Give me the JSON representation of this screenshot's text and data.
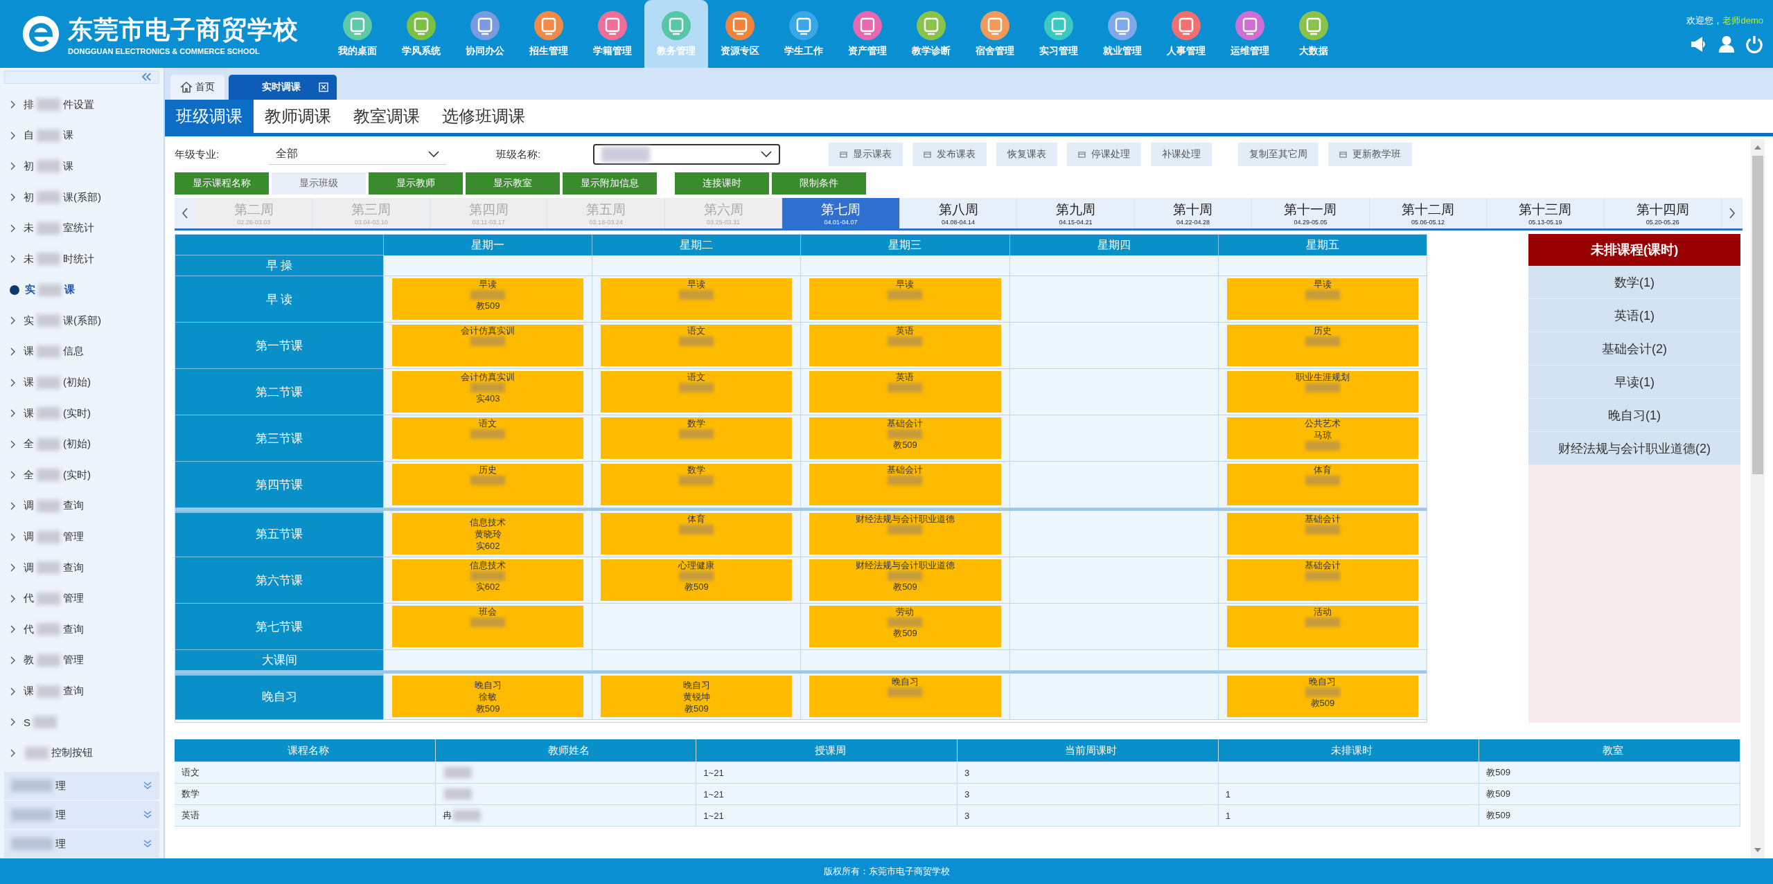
{
  "header": {
    "school_name": "东莞市电子商贸学校",
    "school_name_en": "DONGGUAN ELECTRONICS & COMMERCE SCHOOL",
    "welcome": "欢迎您，",
    "user": "老师demo",
    "nav": [
      {
        "label": "我的桌面",
        "color": "#5cc9a7",
        "selected": false
      },
      {
        "label": "学风系统",
        "color": "#7ac143",
        "selected": false
      },
      {
        "label": "协同办公",
        "color": "#7b9be0",
        "selected": false
      },
      {
        "label": "招生管理",
        "color": "#f08a4b",
        "selected": false
      },
      {
        "label": "学籍管理",
        "color": "#ef6f9a",
        "selected": false
      },
      {
        "label": "教务管理",
        "color": "#56c6a6",
        "selected": true
      },
      {
        "label": "资源专区",
        "color": "#f0843c",
        "selected": false
      },
      {
        "label": "学生工作",
        "color": "#3aa7e8",
        "selected": false
      },
      {
        "label": "资产管理",
        "color": "#e767b0",
        "selected": false
      },
      {
        "label": "教学诊断",
        "color": "#8bc34a",
        "selected": false
      },
      {
        "label": "宿舍管理",
        "color": "#f29a5c",
        "selected": false
      },
      {
        "label": "实习管理",
        "color": "#3cc9c0",
        "selected": false
      },
      {
        "label": "就业管理",
        "color": "#7fa8e8",
        "selected": false
      },
      {
        "label": "人事管理",
        "color": "#f2706f",
        "selected": false
      },
      {
        "label": "运维管理",
        "color": "#cf6fd6",
        "selected": false
      },
      {
        "label": "大数据",
        "color": "#8bc34a",
        "selected": false
      }
    ]
  },
  "sidebar": {
    "items": [
      {
        "prefix": "排",
        "suffix": "件设置",
        "selected": false
      },
      {
        "prefix": "自",
        "suffix": "课",
        "selected": false
      },
      {
        "prefix": "初",
        "suffix": "课",
        "selected": false
      },
      {
        "prefix": "初",
        "suffix": "课(系部)",
        "selected": false
      },
      {
        "prefix": "未",
        "suffix": "室统计",
        "selected": false
      },
      {
        "prefix": "未",
        "suffix": "时统计",
        "selected": false
      },
      {
        "prefix": "实",
        "suffix": "课",
        "selected": true
      },
      {
        "prefix": "实",
        "suffix": "课(系部)",
        "selected": false
      },
      {
        "prefix": "课",
        "suffix": "信息",
        "selected": false
      },
      {
        "prefix": "课",
        "suffix": "(初始)",
        "selected": false
      },
      {
        "prefix": "课",
        "suffix": "(实时)",
        "selected": false
      },
      {
        "prefix": "全",
        "suffix": "(初始)",
        "selected": false
      },
      {
        "prefix": "全",
        "suffix": "(实时)",
        "selected": false
      },
      {
        "prefix": "调",
        "suffix": "查询",
        "selected": false
      },
      {
        "prefix": "调",
        "suffix": "管理",
        "selected": false
      },
      {
        "prefix": "调",
        "suffix": "查询",
        "selected": false
      },
      {
        "prefix": "代",
        "suffix": "管理",
        "selected": false
      },
      {
        "prefix": "代",
        "suffix": "查询",
        "selected": false
      },
      {
        "prefix": "教",
        "suffix": "管理",
        "selected": false
      },
      {
        "prefix": "课",
        "suffix": "查询",
        "selected": false
      },
      {
        "prefix": "S",
        "selected": false
      },
      {
        "suffix": "控制按钮",
        "selected": false
      }
    ],
    "groups": [
      {
        "suffix": "理"
      },
      {
        "suffix": "理"
      },
      {
        "suffix": "理"
      }
    ]
  },
  "tabs": [
    {
      "label": "首页",
      "kind": "home",
      "selected": false
    },
    {
      "label": "实时调课",
      "kind": "closable",
      "selected": true
    }
  ],
  "subtabs": [
    {
      "label": "班级调课",
      "selected": true
    },
    {
      "label": "教师调课",
      "selected": false
    },
    {
      "label": "教室调课",
      "selected": false
    },
    {
      "label": "选修班调课",
      "selected": false
    }
  ],
  "filters": {
    "grade_label": "年级专业:",
    "grade_value": "全部",
    "class_label": "班级名称:"
  },
  "actions": [
    {
      "label": "显示课表",
      "icon": true
    },
    {
      "label": "发布课表",
      "icon": true
    },
    {
      "label": "恢复课表",
      "icon": false
    },
    {
      "label": "停课处理",
      "icon": true
    },
    {
      "label": "补课处理",
      "icon": false
    },
    {
      "label": "复制至其它周",
      "icon": false
    },
    {
      "label": "更新教学班",
      "icon": true
    }
  ],
  "toggles": [
    {
      "label": "显示课程名称",
      "on": true
    },
    {
      "label": "显示班级",
      "on": false
    },
    {
      "label": "显示教师",
      "on": true
    },
    {
      "label": "显示教室",
      "on": true
    },
    {
      "label": "显示附加信息",
      "on": true
    },
    {
      "label": "连接课时",
      "on": true
    },
    {
      "label": "限制条件",
      "on": true
    }
  ],
  "weeks": [
    {
      "label": "第二周",
      "dates": "02.26-03.03",
      "disabled": true,
      "selected": false
    },
    {
      "label": "第三周",
      "dates": "03.04-03.10",
      "disabled": true,
      "selected": false
    },
    {
      "label": "第四周",
      "dates": "03.11-03.17",
      "disabled": true,
      "selected": false
    },
    {
      "label": "第五周",
      "dates": "03.18-03.24",
      "disabled": true,
      "selected": false
    },
    {
      "label": "第六周",
      "dates": "03.25-03.31",
      "disabled": true,
      "selected": false
    },
    {
      "label": "第七周",
      "dates": "04.01-04.07",
      "disabled": false,
      "selected": true
    },
    {
      "label": "第八周",
      "dates": "04.08-04.14",
      "disabled": false,
      "selected": false
    },
    {
      "label": "第九周",
      "dates": "04.15-04.21",
      "disabled": false,
      "selected": false
    },
    {
      "label": "第十周",
      "dates": "04.22-04.28",
      "disabled": false,
      "selected": false
    },
    {
      "label": "第十一周",
      "dates": "04.29-05.05",
      "disabled": false,
      "selected": false
    },
    {
      "label": "第十二周",
      "dates": "05.06-05.12",
      "disabled": false,
      "selected": false
    },
    {
      "label": "第十三周",
      "dates": "05.13-05.19",
      "disabled": false,
      "selected": false
    },
    {
      "label": "第十四周",
      "dates": "05.20-05.26",
      "disabled": false,
      "selected": false
    }
  ],
  "timetable": {
    "days": [
      "星期一",
      "星期二",
      "星期三",
      "星期四",
      "星期五"
    ],
    "periods": [
      {
        "label": "早 操",
        "kind": "break",
        "section_start": false,
        "cells": [
          {
            "kind": "empty"
          },
          {
            "kind": "empty"
          },
          {
            "kind": "empty"
          },
          {
            "kind": "empty"
          },
          {
            "kind": "empty"
          }
        ]
      },
      {
        "label": "早 读",
        "kind": "lesson",
        "section_start": false,
        "cells": [
          {
            "kind": "course",
            "subject": "早读",
            "room": "教509",
            "blurred": true
          },
          {
            "kind": "course",
            "subject": "早读",
            "blurred": true
          },
          {
            "kind": "course",
            "subject": "早读",
            "blurred": true
          },
          {
            "kind": "empty"
          },
          {
            "kind": "course",
            "subject": "早读",
            "blurred": true
          }
        ]
      },
      {
        "label": "第一节课",
        "kind": "lesson",
        "section_start": false,
        "cells": [
          {
            "kind": "course",
            "subject": "会计仿真实训",
            "blurred": true
          },
          {
            "kind": "course",
            "subject": "语文",
            "blurred": true
          },
          {
            "kind": "course",
            "subject": "英语",
            "blurred": true
          },
          {
            "kind": "empty"
          },
          {
            "kind": "course",
            "subject": "历史",
            "blurred": true
          }
        ]
      },
      {
        "label": "第二节课",
        "kind": "lesson",
        "section_start": false,
        "cells": [
          {
            "kind": "course",
            "subject": "会计仿真实训",
            "room": "实403",
            "blurred": true
          },
          {
            "kind": "course",
            "subject": "语文",
            "blurred": true
          },
          {
            "kind": "course",
            "subject": "英语",
            "blurred": true
          },
          {
            "kind": "empty"
          },
          {
            "kind": "course",
            "subject": "职业生涯规划",
            "blurred": true
          }
        ]
      },
      {
        "label": "第三节课",
        "kind": "lesson",
        "section_start": false,
        "cells": [
          {
            "kind": "course",
            "subject": "语文",
            "blurred": true
          },
          {
            "kind": "course",
            "subject": "数学",
            "blurred": true
          },
          {
            "kind": "course",
            "subject": "基础会计",
            "room": "教509",
            "blurred": true
          },
          {
            "kind": "empty"
          },
          {
            "kind": "course",
            "subject": "公共艺术",
            "teacher": "马琼",
            "blurred": true
          }
        ]
      },
      {
        "label": "第四节课",
        "kind": "lesson",
        "section_start": false,
        "cells": [
          {
            "kind": "course",
            "subject": "历史",
            "blurred": true
          },
          {
            "kind": "course",
            "subject": "数学",
            "blurred": true
          },
          {
            "kind": "course",
            "subject": "基础会计",
            "blurred": true
          },
          {
            "kind": "empty"
          },
          {
            "kind": "course",
            "subject": "体育",
            "blurred": true
          }
        ]
      },
      {
        "label": "第五节课",
        "kind": "lesson",
        "section_start": true,
        "cells": [
          {
            "kind": "course",
            "subject": "信息技术",
            "teacher": "黄晓玲",
            "room": "实602",
            "blurred": false
          },
          {
            "kind": "course",
            "subject": "体育",
            "blurred": true
          },
          {
            "kind": "course",
            "subject": "财经法规与会计职业道德",
            "blurred": true
          },
          {
            "kind": "empty"
          },
          {
            "kind": "course",
            "subject": "基础会计",
            "blurred": true
          }
        ]
      },
      {
        "label": "第六节课",
        "kind": "lesson",
        "section_start": false,
        "cells": [
          {
            "kind": "course",
            "subject": "信息技术",
            "room": "实602",
            "blurred": true
          },
          {
            "kind": "course",
            "subject": "心理健康",
            "room": "教509",
            "blurred": true
          },
          {
            "kind": "course",
            "subject": "财经法规与会计职业道德",
            "room": "教509",
            "blurred": true
          },
          {
            "kind": "empty"
          },
          {
            "kind": "course",
            "subject": "基础会计",
            "blurred": true
          }
        ]
      },
      {
        "label": "第七节课",
        "kind": "lesson",
        "section_start": false,
        "cells": [
          {
            "kind": "course",
            "subject": "班会",
            "blurred": true
          },
          {
            "kind": "empty"
          },
          {
            "kind": "course",
            "subject": "劳动",
            "room": "教509",
            "blurred": true
          },
          {
            "kind": "empty"
          },
          {
            "kind": "course",
            "subject": "活动",
            "blurred": true
          }
        ]
      },
      {
        "label": "大课间",
        "kind": "break",
        "section_start": false,
        "cells": [
          {
            "kind": "empty"
          },
          {
            "kind": "empty"
          },
          {
            "kind": "empty"
          },
          {
            "kind": "empty"
          },
          {
            "kind": "empty"
          }
        ]
      },
      {
        "label": "晚自习",
        "kind": "lesson",
        "section_start": true,
        "cells": [
          {
            "kind": "course",
            "subject": "晚自习",
            "teacher": "徐敏",
            "room": "教509",
            "blurred": false
          },
          {
            "kind": "course",
            "subject": "晚自习",
            "teacher": "黄锐坤",
            "room": "教509",
            "blurred": false
          },
          {
            "kind": "course",
            "subject": "晚自习",
            "blurred": true
          },
          {
            "kind": "empty"
          },
          {
            "kind": "course",
            "subject": "晚自习",
            "room": "教509",
            "blurred": true
          }
        ]
      }
    ]
  },
  "unscheduled": {
    "title": "未排课程(课时)",
    "items": [
      "数学(1)",
      "英语(1)",
      "基础会计(2)",
      "早读(1)",
      "晚自习(1)",
      "财经法规与会计职业道德(2)"
    ]
  },
  "courses": {
    "columns": [
      "课程名称",
      "教师姓名",
      "授课周",
      "当前周课时",
      "未排课时",
      "教室"
    ],
    "rows": [
      {
        "course": "语文",
        "weeks": "1~21",
        "hours": "3",
        "room": "教509"
      },
      {
        "course": "数学",
        "weeks": "1~21",
        "hours": "3",
        "unscheduled": "1",
        "room": "教509"
      },
      {
        "course": "英语",
        "teacher": "冉",
        "weeks": "1~21",
        "hours": "3",
        "unscheduled": "1",
        "room": "教509"
      }
    ]
  },
  "footer": "版权所有：东莞市电子商贸学校"
}
